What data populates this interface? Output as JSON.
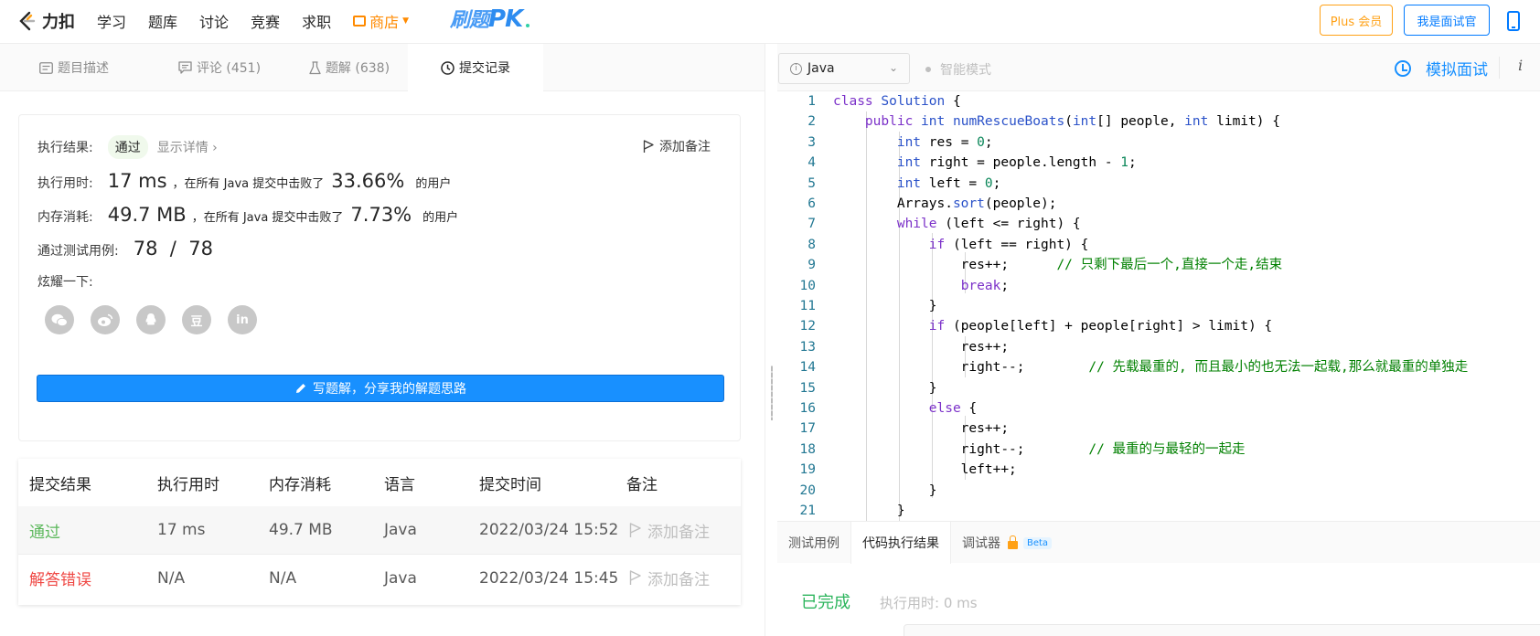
{
  "topnav": {
    "logo_text": "力扣",
    "items": [
      "学习",
      "题库",
      "讨论",
      "竞赛",
      "求职"
    ],
    "store_label": "商店",
    "pk_cn": "刷题",
    "pk_en": "PK",
    "plus_label": "Plus 会员",
    "interviewer_label": "我是面试官"
  },
  "tabs": [
    {
      "label": "题目描述",
      "icon": "description-icon"
    },
    {
      "label": "评论 (451)",
      "icon": "comment-icon"
    },
    {
      "label": "题解 (638)",
      "icon": "flask-icon"
    },
    {
      "label": "提交记录",
      "icon": "clock-icon"
    }
  ],
  "result": {
    "exec_result_label": "执行结果:",
    "status": "通过",
    "detail_link": "显示详情 ›",
    "add_note": "添加备注",
    "time_label": "执行用时:",
    "time_value": "17 ms",
    "time_mid": "，在所有 Java 提交中击败了",
    "time_pct": "33.66%",
    "time_tail": "的用户",
    "mem_label": "内存消耗:",
    "mem_value": "49.7 MB",
    "mem_mid": "，在所有 Java 提交中击败了",
    "mem_pct": "7.73%",
    "mem_tail": "的用户",
    "cases_label": "通过测试用例:",
    "cases_value": "78  /  78",
    "share_label": "炫耀一下:",
    "share_icons": [
      "wechat-icon",
      "weibo-icon",
      "qq-icon",
      "douban-icon",
      "linkedin-icon"
    ],
    "douban_glyph": "豆",
    "linkedin_glyph": "in",
    "write_btn": "写题解，分享我的解题思路"
  },
  "submissions": {
    "headers": [
      "提交结果",
      "执行用时",
      "内存消耗",
      "语言",
      "提交时间",
      "备注"
    ],
    "rows": [
      {
        "status": "通过",
        "time": "17 ms",
        "memory": "49.7 MB",
        "lang": "Java",
        "submitted": "2022/03/24 15:52",
        "note": "添加备注"
      },
      {
        "status": "解答错误",
        "time": "N/A",
        "memory": "N/A",
        "lang": "Java",
        "submitted": "2022/03/24 15:45",
        "note": "添加备注"
      }
    ]
  },
  "editor": {
    "language": "Java",
    "smart_mode": "智能模式",
    "mock_interview": "模拟面试",
    "info": "i",
    "line_numbers": [
      "1",
      "2",
      "3",
      "4",
      "5",
      "6",
      "7",
      "8",
      "9",
      "10",
      "11",
      "12",
      "13",
      "14",
      "15",
      "16",
      "17",
      "18",
      "19",
      "20",
      "21"
    ]
  },
  "console": {
    "tabs": [
      "测试用例",
      "代码执行结果",
      "调试器"
    ],
    "beta": "Beta",
    "status": "已完成",
    "exec_time": "执行用时: 0 ms"
  },
  "colors": {
    "accent": "#1890ff",
    "pass": "#5cb85c",
    "fail": "#ef4743",
    "plus": "#ffa116"
  }
}
